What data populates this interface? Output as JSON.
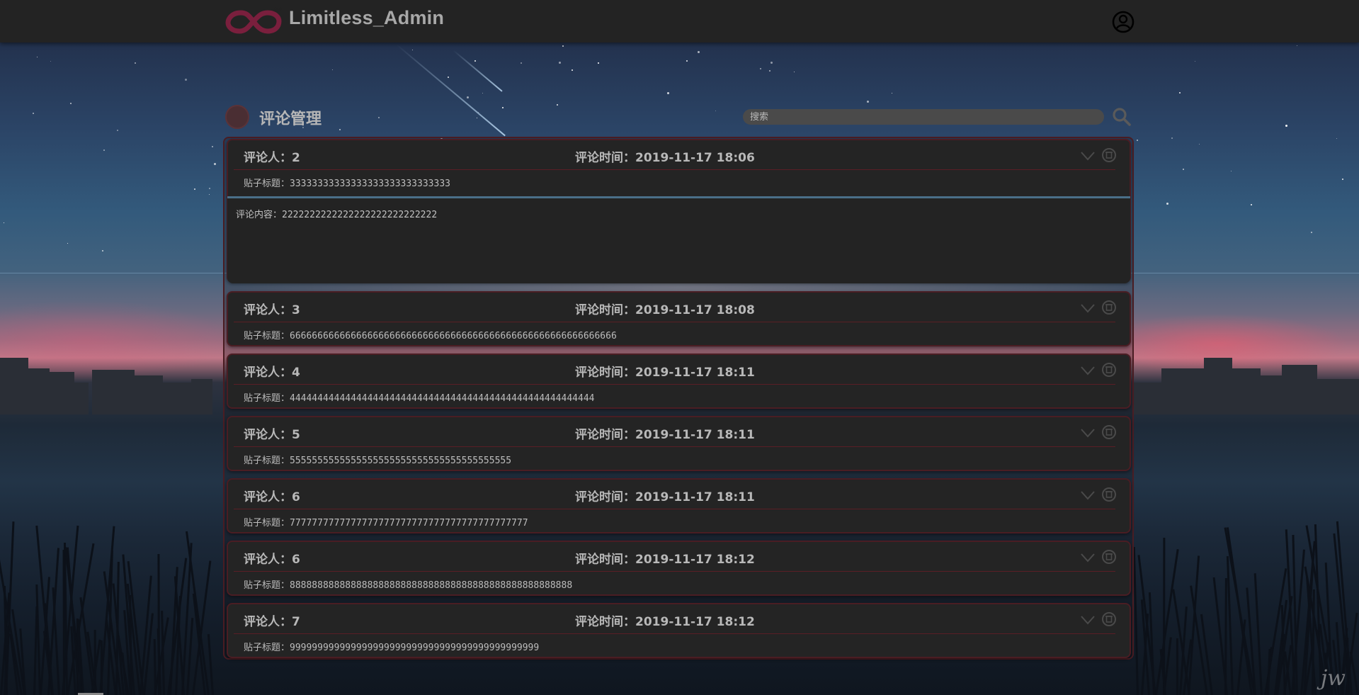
{
  "app": {
    "title": "Limitless_Admin",
    "logo_icon": "infinity-logo-icon",
    "user_icon": "user-circle-icon"
  },
  "section": {
    "title": "评论管理",
    "search_placeholder": "搜索",
    "search_icon": "search-icon"
  },
  "comments": [
    {
      "commenter": "评论人：2",
      "time": "评论时间：2019-11-17 18:06",
      "post_title": "贴子标题：33333333333333333333333333333",
      "expanded": true,
      "content": "评论内容：2222222222222222222222222222"
    },
    {
      "commenter": "评论人：3",
      "time": "评论时间：2019-11-17 18:08",
      "post_title": "贴子标题：66666666666666666666666666666666666666666666666666666666666"
    },
    {
      "commenter": "评论人：4",
      "time": "评论时间：2019-11-17 18:11",
      "post_title": "贴子标题：4444444444444444444444444444444444444444444444444444444"
    },
    {
      "commenter": "评论人：5",
      "time": "评论时间：2019-11-17 18:11",
      "post_title": "贴子标题：5555555555555555555555555555555555555555"
    },
    {
      "commenter": "评论人：6",
      "time": "评论时间：2019-11-17 18:11",
      "post_title": "贴子标题：7777777777777777777777777777777777777777777"
    },
    {
      "commenter": "评论人：6",
      "time": "评论时间：2019-11-17 18:12",
      "post_title": "贴子标题：888888888888888888888888888888888888888888888888888"
    },
    {
      "commenter": "评论人：7",
      "time": "评论时间：2019-11-17 18:12",
      "post_title": "贴子标题：999999999999999999999999999999999999999999999"
    }
  ],
  "card_icons": {
    "expand": "chevron-down-icon",
    "delete": "delete-circle-icon"
  },
  "watermark": "jw",
  "colors": {
    "accent": "#7a1f3d",
    "card_border": "#4a1d23",
    "topbar": "#232323"
  }
}
